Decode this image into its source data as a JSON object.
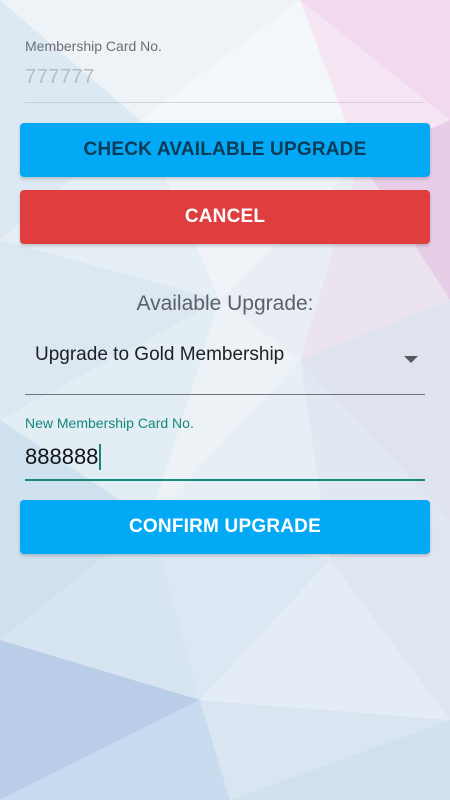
{
  "form": {
    "membership_label": "Membership Card No.",
    "membership_value": "777777",
    "check_button": "CHECK AVAILABLE UPGRADE",
    "cancel_button": "CANCEL",
    "available_title": "Available Upgrade:",
    "upgrade_selected": "Upgrade to Gold Membership",
    "new_card_label": "New Membership Card No.",
    "new_card_value": "888888",
    "confirm_button": "CONFIRM UPGRADE"
  },
  "colors": {
    "primary": "#03a9f4",
    "danger": "#e03e3e",
    "accent": "#14897a"
  },
  "icons": {
    "dropdown": "chevron-down-icon"
  }
}
